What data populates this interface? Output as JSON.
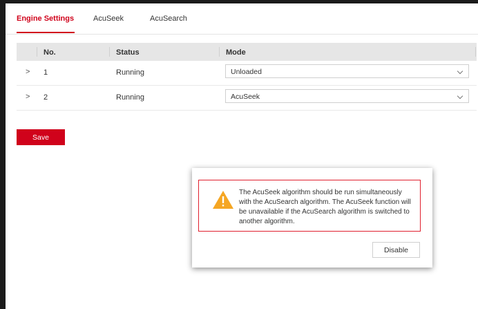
{
  "tabs": [
    {
      "label": "Engine Settings",
      "active": true
    },
    {
      "label": "AcuSeek",
      "active": false
    },
    {
      "label": "AcuSearch",
      "active": false
    }
  ],
  "table": {
    "headers": {
      "no": "No.",
      "status": "Status",
      "mode": "Mode"
    },
    "rows": [
      {
        "no": "1",
        "status": "Running",
        "mode": "Unloaded"
      },
      {
        "no": "2",
        "status": "Running",
        "mode": "AcuSeek"
      }
    ]
  },
  "save_label": "Save",
  "dialog": {
    "message": "The AcuSeek algorithm should be run simultaneously with the AcuSearch algorithm. The AcuSeek function will be unavailable if the AcuSearch algorithm is switched to another algorithm.",
    "button_label": "Disable",
    "icon": "warning-icon"
  },
  "colors": {
    "accent": "#d0021b",
    "warning": "#f5a623"
  }
}
